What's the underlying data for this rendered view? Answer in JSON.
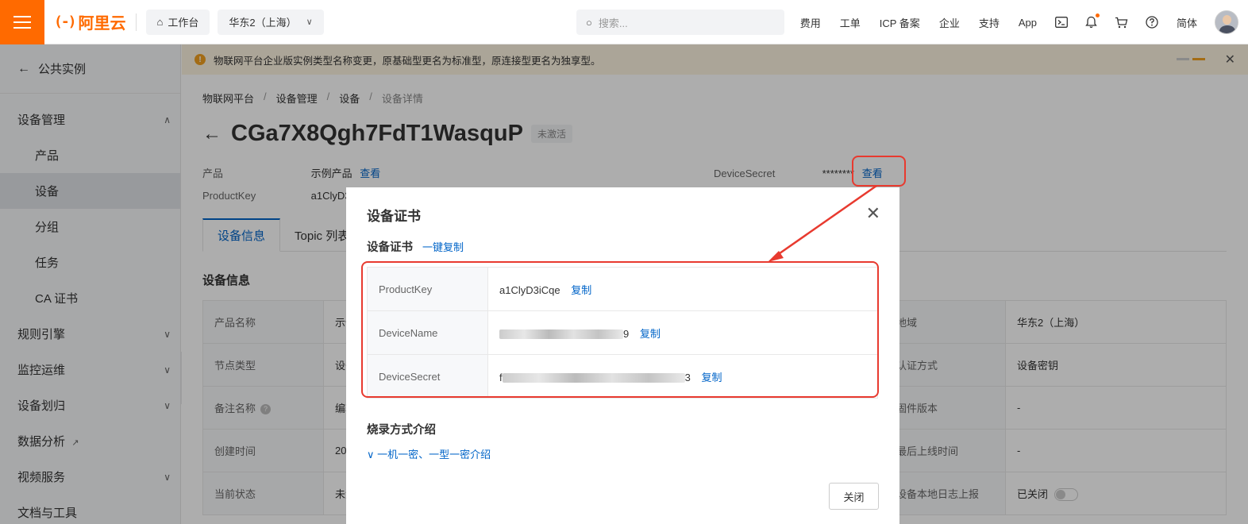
{
  "topbar": {
    "brand": "阿里云",
    "brand_mark": "(-)",
    "workbench": "工作台",
    "region": "华东2（上海）",
    "search_placeholder": "搜索...",
    "nav": [
      "费用",
      "工单",
      "ICP 备案",
      "企业",
      "支持",
      "App"
    ],
    "lang": "简体"
  },
  "sidebar": {
    "back_label": "公共实例",
    "device_mgmt": "设备管理",
    "sub_items": [
      "产品",
      "设备",
      "分组",
      "任务",
      "CA 证书"
    ],
    "groups": [
      "规则引擎",
      "监控运维",
      "设备划归"
    ],
    "data_analysis": "数据分析",
    "video_service": "视频服务",
    "docs_tools": "文档与工具"
  },
  "notice": {
    "text": "物联网平台企业版实例类型名称变更，原基础型更名为标准型，原连接型更名为独享型。"
  },
  "breadcrumb": [
    "物联网平台",
    "设备管理",
    "设备",
    "设备详情"
  ],
  "device": {
    "name": "CGa7X8Qgh7FdT1WasquP",
    "status": "未激活",
    "product_label": "产品",
    "product_value": "示例产品",
    "view_link": "查看",
    "productkey_label": "ProductKey",
    "productkey_value": "a1ClyD3",
    "secret_label": "DeviceSecret",
    "secret_mask": "********",
    "secret_view": "查看"
  },
  "tabs": [
    "设备信息",
    "Topic 列表"
  ],
  "info": {
    "section_title": "设备信息",
    "left_labels": [
      "产品名称",
      "节点类型",
      "备注名称",
      "创建时间",
      "当前状态"
    ],
    "left_values": [
      "示例",
      "设备",
      "编辑",
      "20",
      "未激"
    ],
    "right_labels": [
      "地域",
      "认证方式",
      "固件版本",
      "最后上线时间",
      "设备本地日志上报"
    ],
    "right_values": [
      "华东2（上海）",
      "设备密钥",
      "-",
      "-",
      "已关闭"
    ]
  },
  "modal": {
    "title": "设备证书",
    "cert_heading": "设备证书",
    "copy_all": "一键复制",
    "rows": [
      {
        "key": "ProductKey",
        "value": "a1ClyD3iCqe",
        "copy": "复制"
      },
      {
        "key": "DeviceName",
        "value_tail": "9",
        "copy": "复制"
      },
      {
        "key": "DeviceSecret",
        "value_head": "f",
        "value_tail": "3",
        "copy": "复制"
      }
    ],
    "burn_title": "烧录方式介绍",
    "burn_link": "一机一密、一型一密介绍",
    "close_label": "关闭"
  },
  "colors": {
    "accent": "#ff6a00",
    "link": "#0064c8",
    "annotation": "#e83a2f"
  }
}
